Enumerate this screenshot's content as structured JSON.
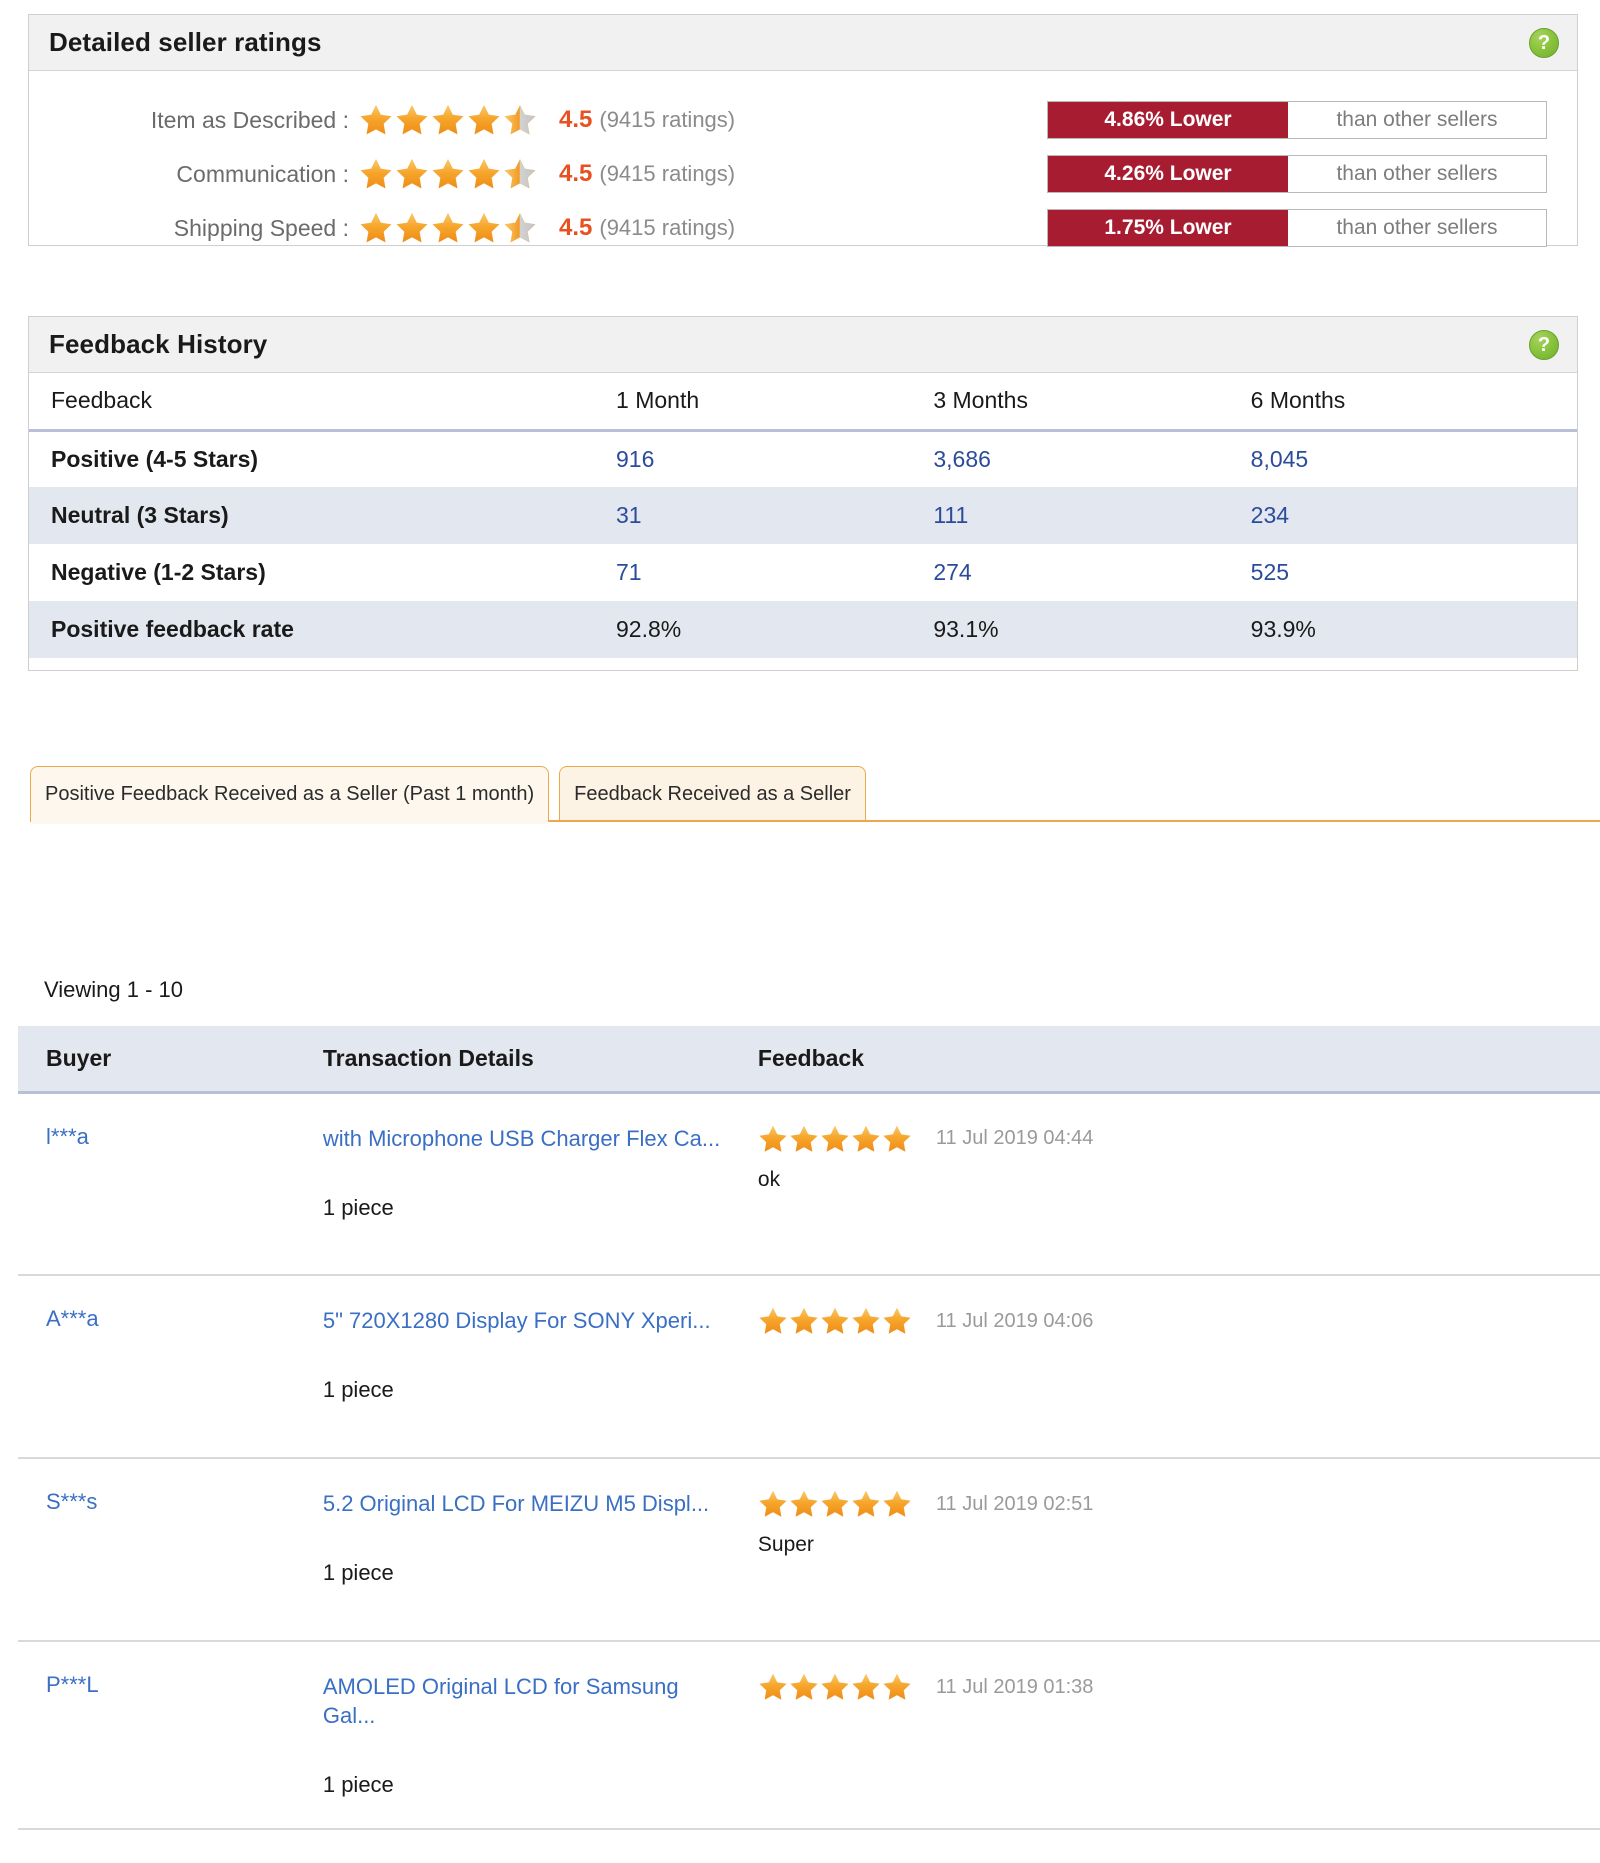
{
  "dsr": {
    "title": "Detailed seller ratings",
    "help_icon": "help-question-icon",
    "help_label": "?",
    "rows": [
      {
        "label": "Item as Described :",
        "stars": 4.5,
        "score": "4.5",
        "count": "(9415 ratings)",
        "compare_pct": "4.86% Lower",
        "compare_text": "than other sellers"
      },
      {
        "label": "Communication :",
        "stars": 4.5,
        "score": "4.5",
        "count": "(9415 ratings)",
        "compare_pct": "4.26% Lower",
        "compare_text": "than other sellers"
      },
      {
        "label": "Shipping Speed :",
        "stars": 4.5,
        "score": "4.5",
        "count": "(9415 ratings)",
        "compare_pct": "1.75% Lower",
        "compare_text": "than other sellers"
      }
    ],
    "colors": {
      "score": "#e8501f",
      "compare_bar": "#a81c32",
      "star": "#f5a12a"
    }
  },
  "feedback_history": {
    "title": "Feedback History",
    "help_icon": "help-question-icon",
    "help_label": "?",
    "columns": [
      "Feedback",
      "1 Month",
      "3 Months",
      "6 Months"
    ],
    "rows": [
      {
        "label": "Positive (4-5 Stars)",
        "values": [
          "916",
          "3,686",
          "8,045"
        ],
        "style": "link"
      },
      {
        "label": "Neutral (3 Stars)",
        "values": [
          "31",
          "111",
          "234"
        ],
        "style": "link"
      },
      {
        "label": "Negative (1-2 Stars)",
        "values": [
          "71",
          "274",
          "525"
        ],
        "style": "link"
      },
      {
        "label": "Positive feedback rate",
        "values": [
          "92.8%",
          "93.1%",
          "93.9%"
        ],
        "style": "plain"
      }
    ]
  },
  "tabs": [
    {
      "label": "Positive Feedback Received as a Seller (Past 1 month)",
      "active": true
    },
    {
      "label": "Feedback Received as a Seller",
      "active": false
    }
  ],
  "viewing": "Viewing 1 - 10",
  "feedback_table": {
    "columns": [
      "Buyer",
      "Transaction Details",
      "Feedback"
    ],
    "rows": [
      {
        "buyer": "l***a",
        "title": "with Microphone USB Charger Flex Ca...",
        "qty": "1 piece",
        "stars": 5,
        "date": "11 Jul 2019 04:44",
        "comment": "ok"
      },
      {
        "buyer": "A***a",
        "title": "5\" 720X1280 Display For SONY Xperi...",
        "qty": "1 piece",
        "stars": 5,
        "date": "11 Jul 2019 04:06",
        "comment": ""
      },
      {
        "buyer": "S***s",
        "title": "5.2 Original LCD For MEIZU M5 Displ...",
        "qty": "1 piece",
        "stars": 5,
        "date": "11 Jul 2019 02:51",
        "comment": "Super"
      },
      {
        "buyer": "P***L",
        "title": "AMOLED Original LCD for Samsung Gal...",
        "qty": "1 piece",
        "stars": 5,
        "date": "11 Jul 2019 01:38",
        "comment": ""
      }
    ]
  }
}
